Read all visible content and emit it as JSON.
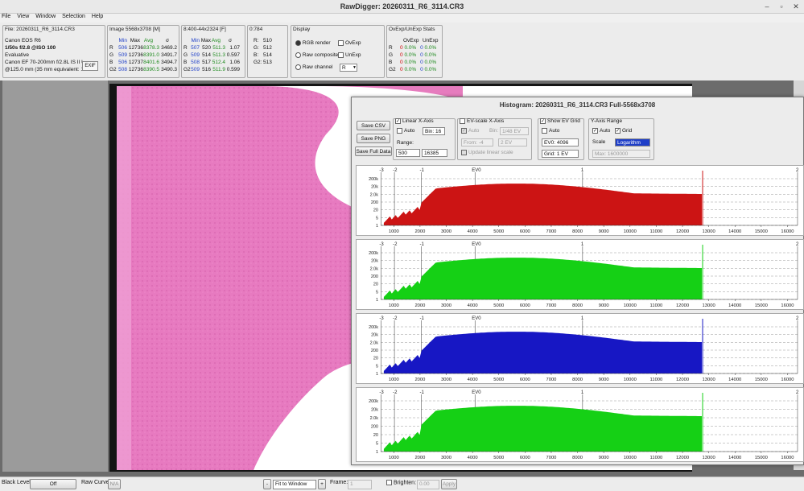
{
  "window": {
    "title": "RawDigger: 20260311_R6_3114.CR3"
  },
  "menu": [
    "File",
    "View",
    "Window",
    "Selection",
    "Help"
  ],
  "file_panel": {
    "title": "File: 20260311_R6_3114.CR3",
    "camera": "Canon EOS R6",
    "exposure": "1/50s f/2.8 @ISO 100",
    "metering": "Evaluative",
    "lens": "Canon EF 70-200mm f/2.8L IS II US",
    "focal": "@125.0 mm (35 mm equivalent: 12",
    "exif_button": "EXIF"
  },
  "image_panel": {
    "title": "Image 5568x3708 [M]",
    "headers": [
      "Min",
      "Max",
      "Avg",
      "σ"
    ],
    "rows": [
      {
        "ch": "R",
        "min": "506",
        "max": "12736",
        "avg": "8378.3",
        "sd": "3469.2"
      },
      {
        "ch": "G",
        "min": "509",
        "max": "12736",
        "avg": "8391.0",
        "sd": "3491.7"
      },
      {
        "ch": "B",
        "min": "506",
        "max": "12737",
        "avg": "8401.6",
        "sd": "3494.7"
      },
      {
        "ch": "G2",
        "min": "508",
        "max": "12736",
        "avg": "8390.5",
        "sd": "3490.3"
      }
    ]
  },
  "sel_panel": {
    "title": "8:400-44x2324 [F]",
    "headers": [
      "Min",
      "Max",
      "Avg",
      "σ"
    ],
    "rows": [
      {
        "ch": "R",
        "min": "507",
        "max": "520",
        "avg": "511.3",
        "sd": "1.07"
      },
      {
        "ch": "G",
        "min": "509",
        "max": "514",
        "avg": "511.3",
        "sd": "0.597"
      },
      {
        "ch": "B",
        "min": "508",
        "max": "517",
        "avg": "512.4",
        "sd": "1.06"
      },
      {
        "ch": "G2",
        "min": "509",
        "max": "516",
        "avg": "511.9",
        "sd": "0.599"
      }
    ]
  },
  "pix_panel": {
    "title": "0:784",
    "rows": [
      {
        "ch": "R:",
        "val": "510"
      },
      {
        "ch": "G:",
        "val": "512"
      },
      {
        "ch": "B:",
        "val": "514"
      },
      {
        "ch": "G2:",
        "val": "513"
      }
    ]
  },
  "display_panel": {
    "title": "Display",
    "rgb_render": "RGB render",
    "raw_composite": "Raw composite",
    "raw_channel": "Raw channel",
    "channel_value": "R",
    "ovexp": "OvExp",
    "unexp": "UnExp"
  },
  "stats_panel": {
    "title": "OvExp/UnExp Stats",
    "headers": [
      "OvExp",
      "UnExp"
    ],
    "rows": [
      {
        "ch": "R",
        "ov": "0",
        "ovp": "0.0%",
        "un": "0",
        "unp": "0.0%"
      },
      {
        "ch": "G",
        "ov": "0",
        "ovp": "0.0%",
        "un": "0",
        "unp": "0.0%"
      },
      {
        "ch": "B",
        "ov": "0",
        "ovp": "0.0%",
        "un": "0",
        "unp": "0.0%"
      },
      {
        "ch": "G2",
        "ov": "0",
        "ovp": "0.0%",
        "un": "0",
        "unp": "0.0%"
      }
    ]
  },
  "histogram": {
    "title": "Histogram: 20260311_R6_3114.CR3 Full-5568x3708",
    "save_csv": "Save CSV",
    "save_png": "Save PNG",
    "save_full": "Save Full Data",
    "linear": {
      "title": "Linear X-Axis",
      "auto": "Auto",
      "bin": "Bin: 16",
      "range": "Range:",
      "from": "500",
      "to": "16385"
    },
    "evscale": {
      "title": "EV-scale X-Axis",
      "auto": "Auto",
      "bin": "Bin:",
      "bin_val": "1/48 EV",
      "from": "From: -4",
      "to": "2 EV",
      "update": "Update linear scale"
    },
    "evgrid": {
      "title": "Show EV Grid",
      "auto": "Auto",
      "ev0": "EV0: 4096",
      "grid": "Grid: 1 EV"
    },
    "yaxis": {
      "title": "Y-Axis Range",
      "auto": "Auto",
      "grid": "Grid",
      "scale_label": "Scale",
      "scale": "Logarithm",
      "max": "Max: 1600000"
    },
    "ev_labels": [
      "-3",
      "-2",
      "-1",
      "EV0",
      "1",
      "2"
    ],
    "y_labels": [
      "200k",
      "20k",
      "2.0k",
      "200",
      "20",
      "5",
      "1"
    ],
    "x_labels": [
      "1000",
      "2000",
      "3000",
      "4000",
      "5000",
      "6000",
      "7000",
      "8000",
      "9000",
      "10000",
      "11000",
      "12000",
      "13000",
      "14000",
      "15000",
      "16000",
      "17000"
    ],
    "channel_colors": [
      "#cc1414",
      "#15d015",
      "#1717c4",
      "#15d015"
    ]
  },
  "statusbar": {
    "black_level": "Black Level:",
    "black_value": "Off",
    "raw_curve": "Raw Curve:",
    "raw_curve_value": "N/A",
    "zoom": "Fit to Window",
    "frame": "Frame:",
    "frame_value": "1",
    "brighten": "Brighten:",
    "brighten_value": "0.00",
    "apply": "Apply"
  }
}
